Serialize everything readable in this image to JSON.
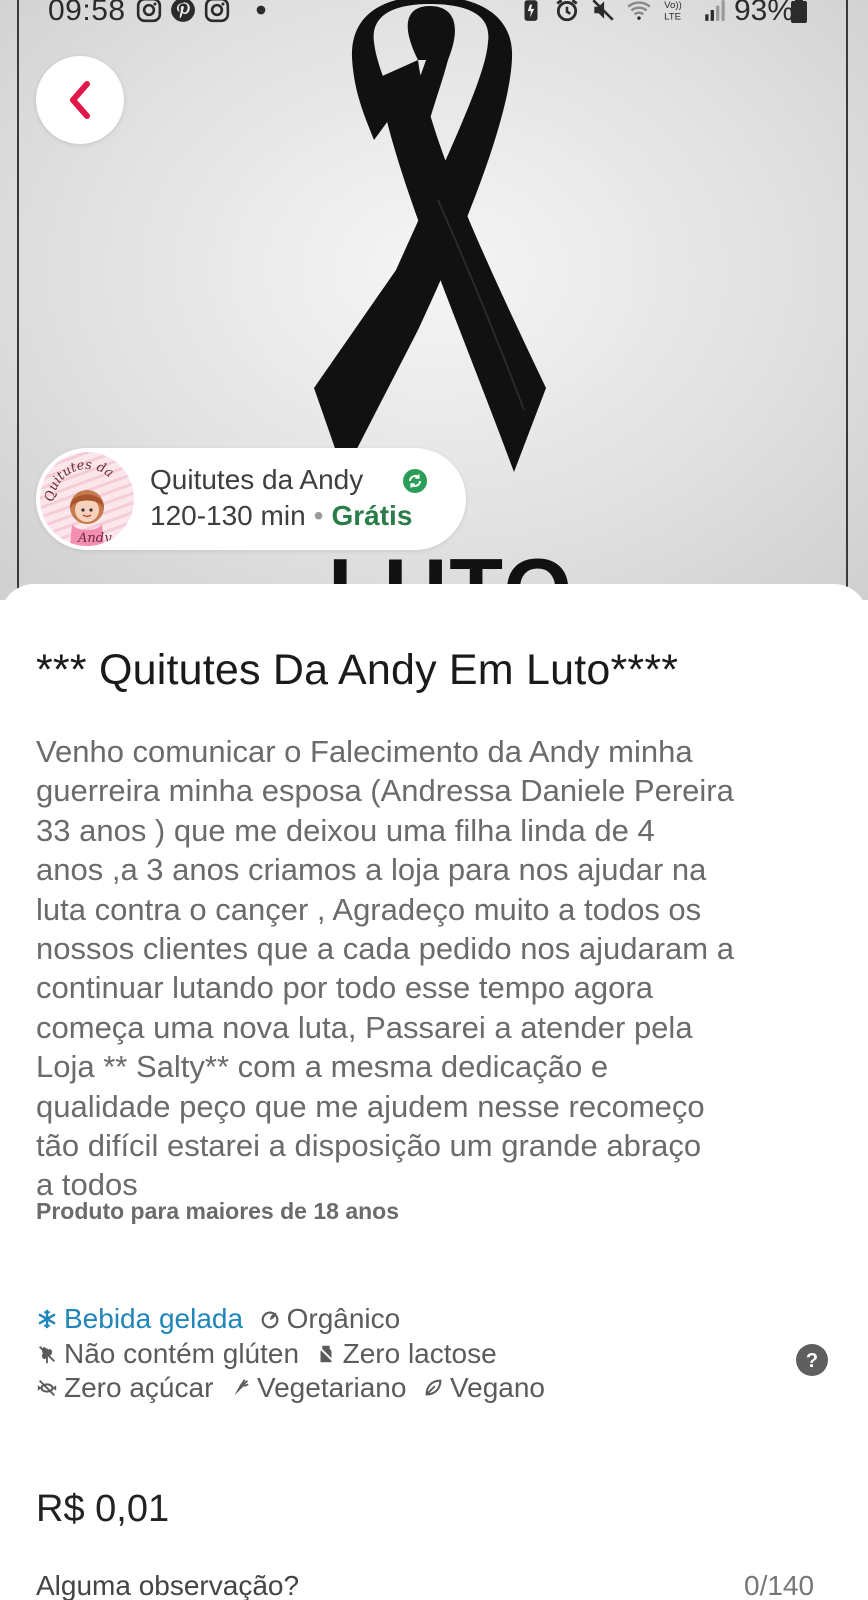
{
  "status_bar": {
    "time": "09:58",
    "battery": "93%",
    "left_icons": [
      "instagram-icon",
      "pinterest-icon",
      "instagram-icon",
      "dot-icon"
    ],
    "right_icons": [
      "battery-saver-icon",
      "alarm-icon",
      "mute-icon",
      "wifi-icon",
      "volte-icon",
      "signal-icon",
      "battery-icon"
    ],
    "volte_label": "Vo)) LTE"
  },
  "hero": {
    "image_text": "LUTO"
  },
  "store": {
    "name": "Quitutes da Andy",
    "delivery_time": "120-130 min",
    "separator": "•",
    "delivery_fee": "Grátis",
    "logo_text": "Quitutes da Andy",
    "verified_color": "#2a9d58"
  },
  "item": {
    "title": "*** Quitutes Da Andy Em Luto****",
    "description": "Venho comunicar o Falecimento da Andy minha\nguerreira minha esposa (Andressa Daniele Pereira\n33 anos ) que me deixou uma filha linda de 4\nanos ,a 3 anos criamos a loja para nos ajudar na\nluta contra o cançer , Agradeço muito a todos os\nnossos clientes que a cada pedido nos ajudaram a\ncontinuar lutando por todo esse tempo agora\ncomeça uma nova luta, Passarei a atender pela\nLoja ** Salty** com a mesma dedicação e\nqualidade peço que me ajudem nesse recomeço\ntão difícil estarei  a disposição um grande abraço\na todos",
    "age_note": "Produto para maiores de 18 anos",
    "tags": [
      {
        "label": "Bebida gelada",
        "icon": "snowflake-icon",
        "highlight": true
      },
      {
        "label": "Orgânico",
        "icon": "organic-icon",
        "highlight": false
      },
      {
        "label": "Não contém glúten",
        "icon": "wheat-icon",
        "highlight": false
      },
      {
        "label": "Zero lactose",
        "icon": "milk-icon",
        "highlight": false
      },
      {
        "label": "Zero açúcar",
        "icon": "candy-icon",
        "highlight": false
      },
      {
        "label": "Vegetariano",
        "icon": "carrot-icon",
        "highlight": false
      },
      {
        "label": "Vegano",
        "icon": "leaf-icon",
        "highlight": false
      }
    ],
    "price": "R$ 0,01",
    "observation_peek": "Alguma observação?",
    "observation_count": "0/140"
  },
  "colors": {
    "accent": "#e0184a",
    "free_green": "#2a7c48",
    "tag_blue": "#1f86b9"
  }
}
